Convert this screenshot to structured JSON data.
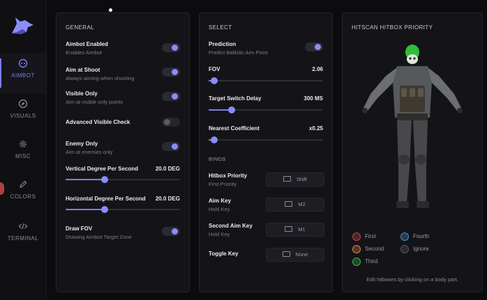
{
  "nav": [
    {
      "label": "AIMBOT",
      "icon": "aimbot-icon",
      "active": true
    },
    {
      "label": "VISUALS",
      "icon": "visuals-icon",
      "active": false
    },
    {
      "label": "MISC",
      "icon": "gear-icon",
      "active": false
    },
    {
      "label": "COLORS",
      "icon": "pencil-icon",
      "active": false
    },
    {
      "label": "TERMINAL",
      "icon": "code-icon",
      "active": false
    }
  ],
  "general": {
    "title": "GENERAL",
    "aimbot_enabled": {
      "label": "Aimbot Enabled",
      "sub": "Enables Aimbot",
      "on": true
    },
    "aim_at_shoot": {
      "label": "Aim at Shoot",
      "sub": "Always aiming when shooting",
      "on": true
    },
    "visible_only": {
      "label": "Visible Only",
      "sub": "Aim at visible only points",
      "on": true
    },
    "advanced_visible_check": {
      "label": "Advanced Visible Check",
      "on": false
    },
    "enemy_only": {
      "label": "Enemy Only",
      "sub": "Aim at enemies only",
      "on": true
    },
    "vertical_degree": {
      "label": "Vertical Degree Per Second",
      "value": "20.0 DEG",
      "fraction": 0.34
    },
    "horizontal_degree": {
      "label": "Horizontal Degree Per Second",
      "value": "20.0 DEG",
      "fraction": 0.34
    },
    "draw_fov": {
      "label": "Draw FOV",
      "sub": "Drawing Aimbot Target Zone",
      "on": true
    }
  },
  "select": {
    "title": "SELECT",
    "prediction": {
      "label": "Prediction",
      "sub": "Predict Ballistic Aim Point",
      "on": true
    },
    "fov": {
      "label": "FOV",
      "value": "2.06",
      "fraction": 0.05
    },
    "target_switch_delay": {
      "label": "Target Switch Delay",
      "value": "300 MS",
      "fraction": 0.2
    },
    "nearest_coefficient": {
      "label": "Nearest Coefficient",
      "value": "x0.25",
      "fraction": 0.05
    },
    "binds_title": "BINDS",
    "binds": [
      {
        "label": "Hitbox Priority",
        "sub": "First Priority",
        "key": "Shift"
      },
      {
        "label": "Aim Key",
        "sub": "Hold Key",
        "key": "M2"
      },
      {
        "label": "Second Aim Key",
        "sub": "Hold Key",
        "key": "M1"
      },
      {
        "label": "Toggle Key",
        "sub": "",
        "key": "None"
      }
    ]
  },
  "hitscan": {
    "title": "HITSCAN HITBOX PRIORITY",
    "legend": [
      {
        "label": "First",
        "color": "#c8424c"
      },
      {
        "label": "Fourth",
        "color": "#3f8fd6"
      },
      {
        "label": "Second",
        "color": "#d6844a"
      },
      {
        "label": "Ignore",
        "color": "#4a4a52"
      },
      {
        "label": "Third",
        "color": "#3fb24a"
      }
    ],
    "footnote": "Edit hitboxes by clicking on a body part."
  }
}
